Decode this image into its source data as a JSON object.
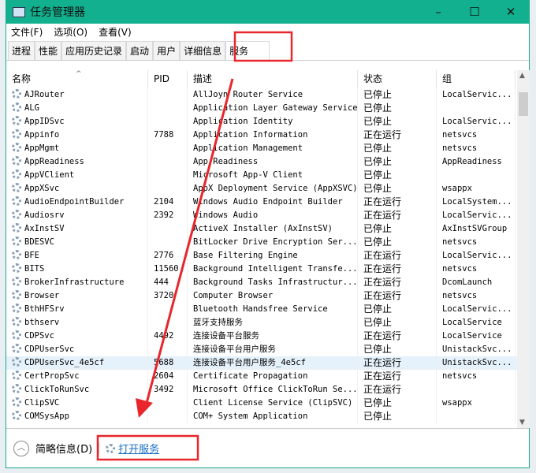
{
  "window": {
    "title": "任务管理器",
    "minimize": "–",
    "maximize": "☐",
    "close": "✕"
  },
  "menu": [
    "文件(F)",
    "选项(O)",
    "查看(V)"
  ],
  "tabs": [
    {
      "label": "进程"
    },
    {
      "label": "性能"
    },
    {
      "label": "应用历史记录"
    },
    {
      "label": "启动"
    },
    {
      "label": "用户"
    },
    {
      "label": "详细信息"
    },
    {
      "label": "服务",
      "active": true
    }
  ],
  "columns": [
    "名称",
    "PID",
    "描述",
    "状态",
    "组"
  ],
  "rows": [
    [
      "AJRouter",
      "",
      "AllJoyn Router Service",
      "已停止",
      "LocalServic..."
    ],
    [
      "ALG",
      "",
      "Application Layer Gateway Service",
      "已停止",
      ""
    ],
    [
      "AppIDSvc",
      "",
      "Application Identity",
      "已停止",
      "LocalServic..."
    ],
    [
      "Appinfo",
      "7788",
      "Application Information",
      "正在运行",
      "netsvcs"
    ],
    [
      "AppMgmt",
      "",
      "Application Management",
      "已停止",
      "netsvcs"
    ],
    [
      "AppReadiness",
      "",
      "App Readiness",
      "已停止",
      "AppReadiness"
    ],
    [
      "AppVClient",
      "",
      "Microsoft App-V Client",
      "已停止",
      ""
    ],
    [
      "AppXSvc",
      "",
      "AppX Deployment Service (AppXSVC)",
      "已停止",
      "wsappx"
    ],
    [
      "AudioEndpointBuilder",
      "2104",
      "Windows Audio Endpoint Builder",
      "正在运行",
      "LocalSystem..."
    ],
    [
      "Audiosrv",
      "2392",
      "Windows Audio",
      "正在运行",
      "LocalServic..."
    ],
    [
      "AxInstSV",
      "",
      "ActiveX Installer (AxInstSV)",
      "已停止",
      "AxInstSVGroup"
    ],
    [
      "BDESVC",
      "",
      "BitLocker Drive Encryption Ser...",
      "已停止",
      "netsvcs"
    ],
    [
      "BFE",
      "2776",
      "Base Filtering Engine",
      "正在运行",
      "LocalServic..."
    ],
    [
      "BITS",
      "11560",
      "Background Intelligent Transfe...",
      "正在运行",
      "netsvcs"
    ],
    [
      "BrokerInfrastructure",
      "444",
      "Background Tasks Infrastructur...",
      "正在运行",
      "DcomLaunch"
    ],
    [
      "Browser",
      "3720",
      "Computer Browser",
      "正在运行",
      "netsvcs"
    ],
    [
      "BthHFSrv",
      "",
      "Bluetooth Handsfree Service",
      "已停止",
      "LocalServic..."
    ],
    [
      "bthserv",
      "",
      "蓝牙支持服务",
      "已停止",
      "LocalService"
    ],
    [
      "CDPSvc",
      "4492",
      "连接设备平台服务",
      "正在运行",
      "LocalService"
    ],
    [
      "CDPUserSvc",
      "",
      "连接设备平台用户服务",
      "已停止",
      "UnistackSvc..."
    ],
    [
      "CDPUserSvc_4e5cf",
      "5688",
      "连接设备平台用户服务_4e5cf",
      "正在运行",
      "UnistackSvc..."
    ],
    [
      "CertPropSvc",
      "2604",
      "Certificate Propagation",
      "正在运行",
      "netsvcs"
    ],
    [
      "ClickToRunSvc",
      "3492",
      "Microsoft Office ClickToRun Se...",
      "正在运行",
      ""
    ],
    [
      "ClipSVC",
      "",
      "Client License Service (ClipSVC)",
      "已停止",
      "wsappx"
    ],
    [
      "COMSysApp",
      "",
      "COM+ System Application",
      "已停止",
      ""
    ]
  ],
  "selected_row": 20,
  "footer": {
    "brief": "简略信息(D)",
    "open_services": "打开服务"
  },
  "annotation_color": "#e8262b",
  "theme": {
    "titlebar": "#12b08e"
  }
}
